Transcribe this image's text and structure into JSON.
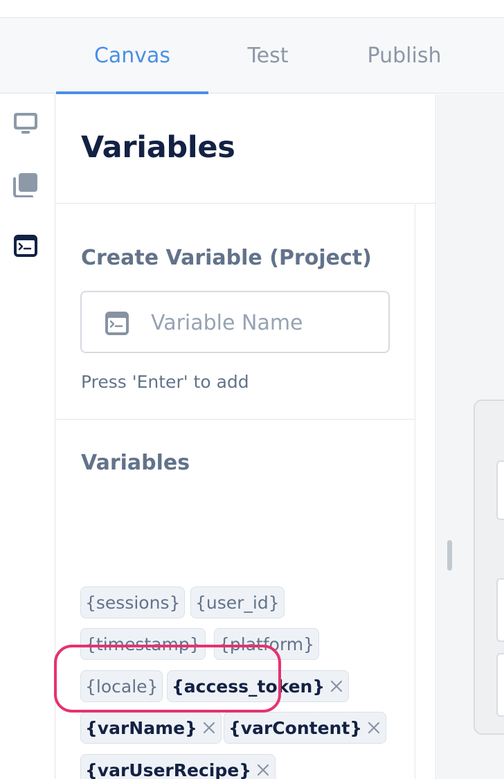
{
  "tabs": [
    {
      "label": "Canvas",
      "active": true
    },
    {
      "label": "Test",
      "active": false
    },
    {
      "label": "Publish",
      "active": false
    }
  ],
  "rail": {
    "icons": [
      "monitor-icon",
      "library-icon",
      "variables-icon"
    ],
    "active_icon": "variables-icon"
  },
  "panel": {
    "title": "Variables",
    "create": {
      "heading": "Create Variable (Project)",
      "placeholder": "Variable Name",
      "value": "",
      "hint": "Press 'Enter' to add"
    },
    "variables": {
      "heading": "Variables",
      "chips": [
        {
          "label": "{sessions}",
          "removable": false
        },
        {
          "label": "{user_id}",
          "removable": false
        },
        {
          "label": "{timestamp}",
          "removable": false
        },
        {
          "label": "{platform}",
          "removable": false
        },
        {
          "label": "{locale}",
          "removable": false
        },
        {
          "label": "{access_token}",
          "removable": true
        },
        {
          "label": "{varName}",
          "removable": true
        },
        {
          "label": "{varContent}",
          "removable": true
        },
        {
          "label": "{varUserRecipe}",
          "removable": true,
          "highlighted": true
        }
      ]
    }
  },
  "colors": {
    "accent": "#4a90e2",
    "title": "#132144",
    "muted": "#62738a",
    "highlight": "#e6326e"
  }
}
